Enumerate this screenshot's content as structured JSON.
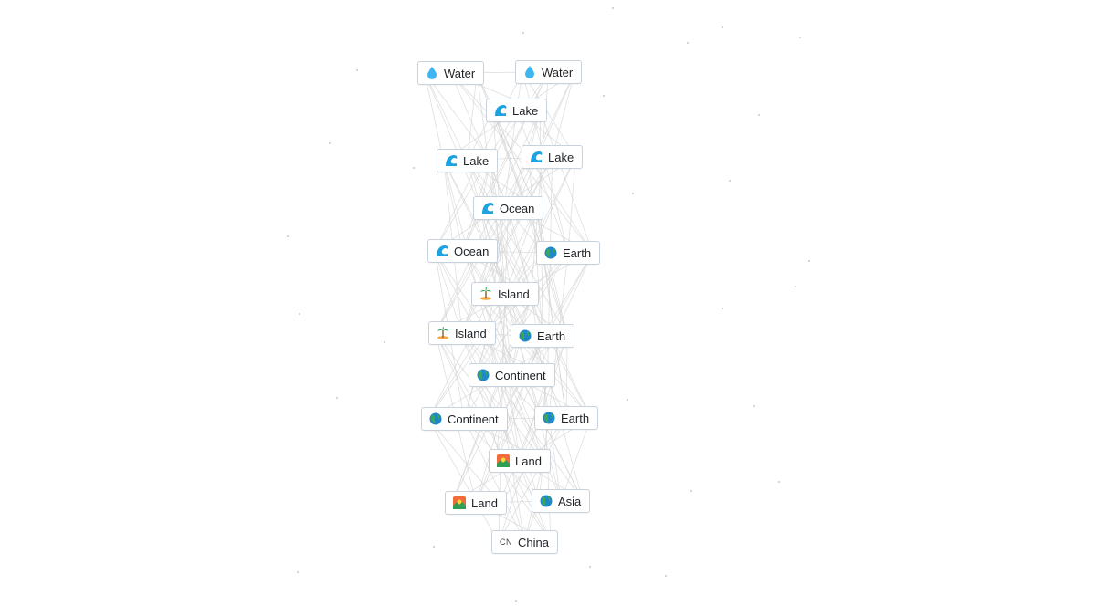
{
  "nodes": [
    {
      "label": "Water",
      "icon": "water-drop-icon"
    },
    {
      "label": "Water",
      "icon": "water-drop-icon"
    },
    {
      "label": "Lake",
      "icon": "wave-icon"
    },
    {
      "label": "Lake",
      "icon": "wave-icon"
    },
    {
      "label": "Lake",
      "icon": "wave-icon"
    },
    {
      "label": "Ocean",
      "icon": "wave-icon"
    },
    {
      "label": "Ocean",
      "icon": "wave-icon"
    },
    {
      "label": "Earth",
      "icon": "globe-icon"
    },
    {
      "label": "Island",
      "icon": "palm-island-icon"
    },
    {
      "label": "Island",
      "icon": "palm-island-icon"
    },
    {
      "label": "Earth",
      "icon": "globe-icon"
    },
    {
      "label": "Continent",
      "icon": "globe-icon"
    },
    {
      "label": "Continent",
      "icon": "globe-icon"
    },
    {
      "label": "Earth",
      "icon": "globe-icon"
    },
    {
      "label": "Land",
      "icon": "landscape-icon"
    },
    {
      "label": "Land",
      "icon": "landscape-icon"
    },
    {
      "label": "Asia",
      "icon": "globe-icon"
    },
    {
      "label": "China",
      "icon": "flag-cn-icon",
      "icon_text": "CN"
    }
  ],
  "colors": {
    "water": "#3fb6f0",
    "wave": "#1aa3e0",
    "globe_ocean": "#1e88c8",
    "globe_land": "#3aa856",
    "edge": "#d4d4d4",
    "node_border": "#c9d2dc"
  }
}
